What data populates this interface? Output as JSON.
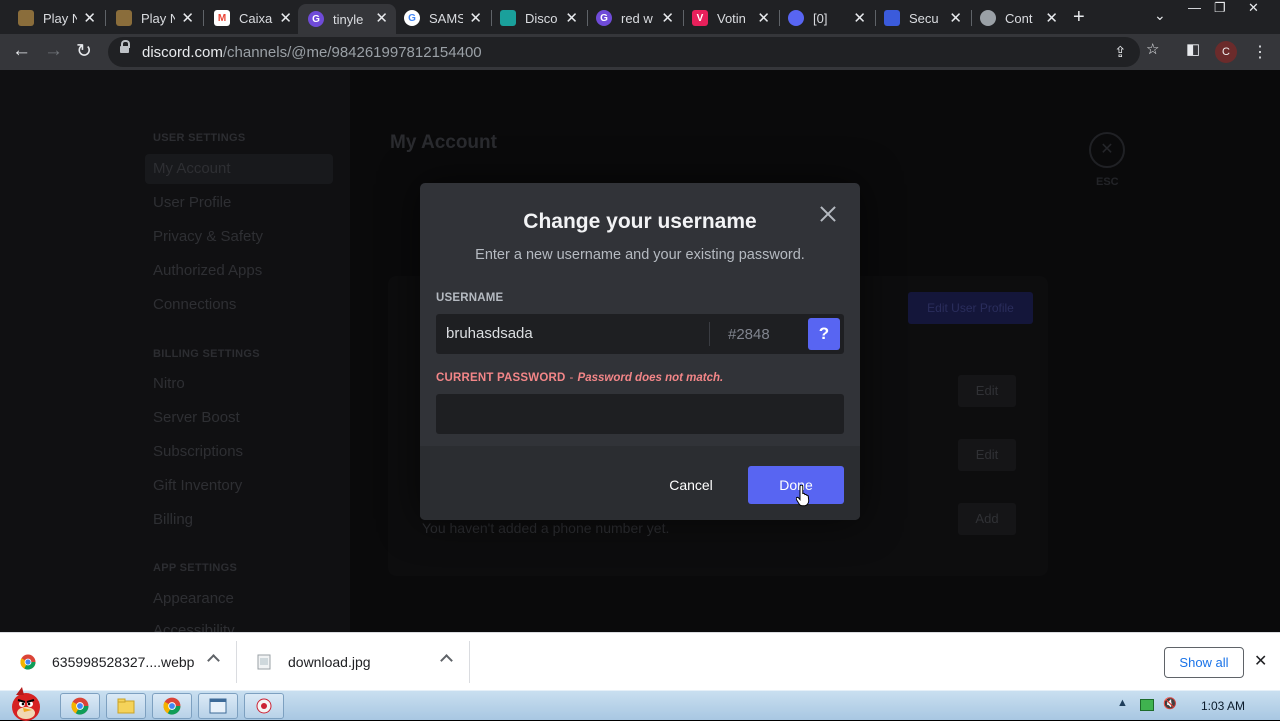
{
  "browser": {
    "tabs": [
      {
        "label": "Play N",
        "icon": "gamepad-favicon-icon",
        "color": "#8a6d3b"
      },
      {
        "label": "Play N",
        "icon": "gamepad-favicon-icon",
        "color": "#8a6d3b"
      },
      {
        "label": "Caixa",
        "icon": "gmail-favicon-icon",
        "color": "#ea4335"
      },
      {
        "label": "tinyle",
        "icon": "tinylink-favicon-icon",
        "color": "#6f4bd8"
      },
      {
        "label": "SAMS",
        "icon": "google-favicon-icon",
        "color": "#4285f4"
      },
      {
        "label": "Disco",
        "icon": "discord-favicon-icon",
        "color": "#1aa09b"
      },
      {
        "label": "red w",
        "icon": "tinylink-favicon-icon",
        "color": "#6f4bd8"
      },
      {
        "label": "Votin",
        "icon": "voting-favicon-icon",
        "color": "#e8205b"
      },
      {
        "label": "[0]",
        "icon": "discord-favicon-icon",
        "color": "#5865f2"
      },
      {
        "label": "Secu",
        "icon": "shield-favicon-icon",
        "color": "#3b5bdb"
      },
      {
        "label": "Cont",
        "icon": "settings-favicon-icon",
        "color": "#9aa0a6"
      }
    ],
    "active_tab_index": 3,
    "url_host": "discord.com",
    "url_path": "/channels/@me/984261997812154400",
    "profile_initial": "C"
  },
  "page": {
    "sidebar": {
      "user_settings_header": "USER SETTINGS",
      "user_items": [
        "My Account",
        "User Profile",
        "Privacy & Safety",
        "Authorized Apps",
        "Connections"
      ],
      "billing_header": "BILLING SETTINGS",
      "billing_items": [
        "Nitro",
        "Server Boost",
        "Subscriptions",
        "Gift Inventory",
        "Billing"
      ],
      "app_header": "APP SETTINGS",
      "app_items": [
        "Appearance",
        "Accessibility"
      ]
    },
    "main_title": "My Account",
    "esc_label": "ESC",
    "edit_profile_label": "Edit User Profile",
    "edit_label": "Edit",
    "add_label": "Add",
    "phone_note": "You haven't added a phone number yet."
  },
  "modal": {
    "title": "Change your username",
    "subtitle": "Enter a new username and your existing password.",
    "username_label": "USERNAME",
    "username_value": "bruhasdsada",
    "discriminator": "#2848",
    "help_label": "?",
    "password_label": "CURRENT PASSWORD",
    "password_separator": "-",
    "password_error": "Password does not match.",
    "password_value": "",
    "cancel_label": "Cancel",
    "done_label": "Done"
  },
  "downloads": {
    "items": [
      {
        "name": "635998528327....webp",
        "icon": "chrome-file-icon"
      },
      {
        "name": "download.jpg",
        "icon": "image-file-icon"
      }
    ],
    "show_all_label": "Show all"
  },
  "taskbar": {
    "clock": "1:03 AM"
  },
  "colors": {
    "discord_blurple": "#5865f2",
    "error_red": "#f38688",
    "modal_bg": "#313338"
  }
}
